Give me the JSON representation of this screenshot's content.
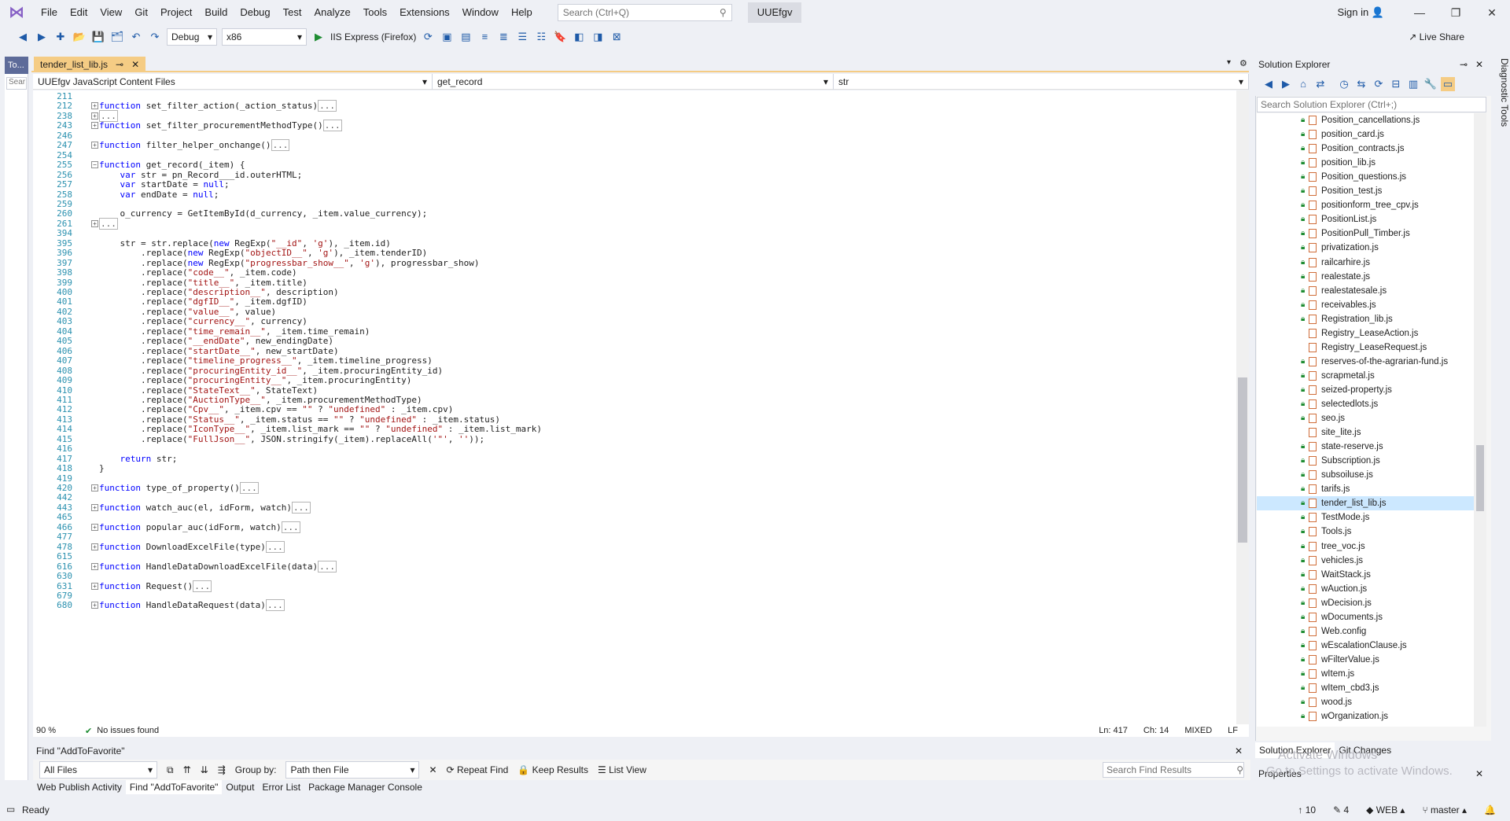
{
  "menu": [
    "File",
    "Edit",
    "View",
    "Git",
    "Project",
    "Build",
    "Debug",
    "Test",
    "Analyze",
    "Tools",
    "Extensions",
    "Window",
    "Help"
  ],
  "search_placeholder": "Search (Ctrl+Q)",
  "solution_name": "UUEfgv",
  "signin": "Sign in",
  "toolbar": {
    "config": "Debug",
    "platform": "x86",
    "run": "IIS Express (Firefox)",
    "live_share": "Live Share"
  },
  "toolbox_tab": "To...",
  "toolbox_search": "Sear",
  "editor_tab": "tender_list_lib.js",
  "nav": {
    "project": "UUEfgv JavaScript Content Files",
    "member": "get_record",
    "scope": "str"
  },
  "code_lines": [
    {
      "n": "211",
      "t": ""
    },
    {
      "n": "212",
      "t": "function set_filter_action(_action_status)",
      "fold": "+",
      "col": true
    },
    {
      "n": "238",
      "t": "",
      "fold": "+",
      "col": true
    },
    {
      "n": "243",
      "t": "function set_filter_procurementMethodType()",
      "fold": "+",
      "col": true
    },
    {
      "n": "246",
      "t": ""
    },
    {
      "n": "247",
      "t": "function filter_helper_onchange()",
      "fold": "+",
      "col": true
    },
    {
      "n": "254",
      "t": ""
    },
    {
      "n": "255",
      "t": "function get_record(_item) {",
      "fold": "-"
    },
    {
      "n": "256",
      "t": "    var str = pn_Record___id.outerHTML;"
    },
    {
      "n": "257",
      "t": "    var startDate = null;"
    },
    {
      "n": "258",
      "t": "    var endDate = null;"
    },
    {
      "n": "259",
      "t": ""
    },
    {
      "n": "260",
      "t": "    o_currency = GetItemById(d_currency, _item.value_currency);"
    },
    {
      "n": "261",
      "t": "",
      "fold": "+",
      "col": true
    },
    {
      "n": "394",
      "t": ""
    },
    {
      "n": "395",
      "t": "    str = str.replace(new RegExp(\"__id\", 'g'), _item.id)"
    },
    {
      "n": "396",
      "t": "        .replace(new RegExp(\"objectID__\", 'g'), _item.tenderID)"
    },
    {
      "n": "397",
      "t": "        .replace(new RegExp(\"progressbar_show__\", 'g'), progressbar_show)"
    },
    {
      "n": "398",
      "t": "        .replace(\"code__\", _item.code)"
    },
    {
      "n": "399",
      "t": "        .replace(\"title__\", _item.title)"
    },
    {
      "n": "400",
      "t": "        .replace(\"description__\", description)"
    },
    {
      "n": "401",
      "t": "        .replace(\"dgfID__\", _item.dgfID)"
    },
    {
      "n": "402",
      "t": "        .replace(\"value__\", value)"
    },
    {
      "n": "403",
      "t": "        .replace(\"currency__\", currency)"
    },
    {
      "n": "404",
      "t": "        .replace(\"time_remain__\", _item.time_remain)"
    },
    {
      "n": "405",
      "t": "        .replace(\"__endDate\", new_endingDate)"
    },
    {
      "n": "406",
      "t": "        .replace(\"startDate__\", new_startDate)"
    },
    {
      "n": "407",
      "t": "        .replace(\"timeline_progress__\", _item.timeline_progress)"
    },
    {
      "n": "408",
      "t": "        .replace(\"procuringEntity_id__\", _item.procuringEntity_id)"
    },
    {
      "n": "409",
      "t": "        .replace(\"procuringEntity__\", _item.procuringEntity)"
    },
    {
      "n": "410",
      "t": "        .replace(\"StateText__\", StateText)"
    },
    {
      "n": "411",
      "t": "        .replace(\"AuctionType__\", _item.procurementMethodType)"
    },
    {
      "n": "412",
      "t": "        .replace(\"Cpv__\", _item.cpv == \"\" ? \"undefined\" : _item.cpv)"
    },
    {
      "n": "413",
      "t": "        .replace(\"Status__\", _item.status == \"\" ? \"undefined\" : _item.status)"
    },
    {
      "n": "414",
      "t": "        .replace(\"IconType__\", _item.list_mark == \"\" ? \"undefined\" : _item.list_mark)"
    },
    {
      "n": "415",
      "t": "        .replace(\"FullJson__\", JSON.stringify(_item).replaceAll('\"', ''));"
    },
    {
      "n": "416",
      "t": ""
    },
    {
      "n": "417",
      "t": "    return str;"
    },
    {
      "n": "418",
      "t": "}"
    },
    {
      "n": "419",
      "t": ""
    },
    {
      "n": "420",
      "t": "function type_of_property()",
      "fold": "+",
      "col": true
    },
    {
      "n": "442",
      "t": ""
    },
    {
      "n": "443",
      "t": "function watch_auc(el, idForm, watch)",
      "fold": "+",
      "col": true
    },
    {
      "n": "465",
      "t": ""
    },
    {
      "n": "466",
      "t": "function popular_auc(idForm, watch)",
      "fold": "+",
      "col": true
    },
    {
      "n": "477",
      "t": ""
    },
    {
      "n": "478",
      "t": "function DownloadExcelFile(type)",
      "fold": "+",
      "col": true
    },
    {
      "n": "615",
      "t": ""
    },
    {
      "n": "616",
      "t": "function HandleDataDownloadExcelFile(data)",
      "fold": "+",
      "col": true
    },
    {
      "n": "630",
      "t": ""
    },
    {
      "n": "631",
      "t": "function Request()",
      "fold": "+",
      "col": true
    },
    {
      "n": "679",
      "t": ""
    },
    {
      "n": "680",
      "t": "function HandleDataRequest(data)",
      "fold": "+",
      "col": true
    }
  ],
  "editor_status": {
    "zoom": "90 %",
    "issues": "No issues found",
    "ln": "Ln: 417",
    "ch": "Ch: 14",
    "mode": "MIXED",
    "eol": "LF"
  },
  "solution_explorer": {
    "title": "Solution Explorer",
    "search": "Search Solution Explorer (Ctrl+;)",
    "files": [
      "Position_cancellations.js",
      "position_card.js",
      "Position_contracts.js",
      "position_lib.js",
      "Position_questions.js",
      "Position_test.js",
      "positionform_tree_cpv.js",
      "PositionList.js",
      "PositionPull_Timber.js",
      "privatization.js",
      "railcarhire.js",
      "realestate.js",
      "realestatesale.js",
      "receivables.js",
      "Registration_lib.js",
      "Registry_LeaseAction.js",
      "Registry_LeaseRequest.js",
      "reserves-of-the-agrarian-fund.js",
      "scrapmetal.js",
      "seized-property.js",
      "selectedlots.js",
      "seo.js",
      "site_lite.js",
      "state-reserve.js",
      "Subscription.js",
      "subsoiluse.js",
      "tarifs.js",
      "tender_list_lib.js",
      "TestMode.js",
      "Tools.js",
      "tree_voc.js",
      "vehicles.js",
      "WaitStack.js",
      "wAuction.js",
      "wDecision.js",
      "wDocuments.js",
      "Web.config",
      "wEscalationClause.js",
      "wFilterValue.js",
      "wItem.js",
      "wItem_cbd3.js",
      "wood.js",
      "wOrganization.js"
    ],
    "selected": "tender_list_lib.js",
    "tabs": [
      "Solution Explorer",
      "Git Changes"
    ],
    "properties": "Properties",
    "watermark1": "Activate Windows",
    "watermark2": "Go to Settings to activate Windows."
  },
  "diagnostic_tools": "Diagnostic Tools",
  "find": {
    "title": "Find \"AddToFavorite\"",
    "scope": "All Files",
    "group_by_label": "Group by:",
    "group_by": "Path then File",
    "repeat": "Repeat Find",
    "keep": "Keep Results",
    "list": "List View",
    "search": "Search Find Results"
  },
  "bottom_tabs": [
    "Web Publish Activity",
    "Find \"AddToFavorite\"",
    "Output",
    "Error List",
    "Package Manager Console"
  ],
  "status": {
    "ready": "Ready",
    "up": "10",
    "edits": "4",
    "repo": "WEB",
    "branch": "master"
  }
}
